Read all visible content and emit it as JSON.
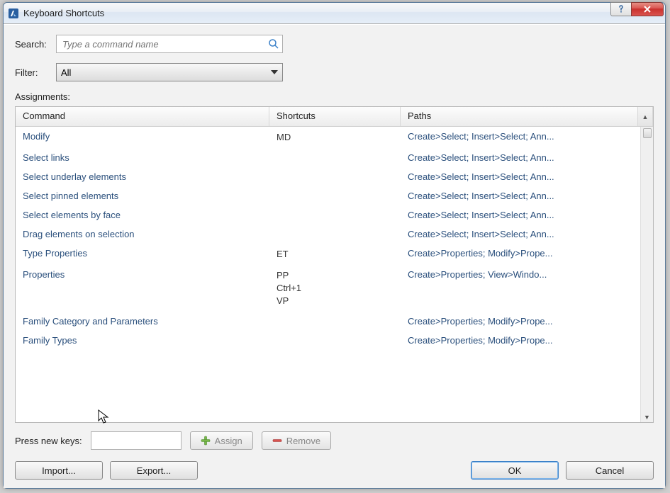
{
  "window": {
    "title": "Keyboard Shortcuts"
  },
  "search": {
    "label": "Search:",
    "placeholder": "Type a command name"
  },
  "filter": {
    "label": "Filter:",
    "value": "All"
  },
  "assignments_label": "Assignments:",
  "columns": {
    "command": "Command",
    "shortcuts": "Shortcuts",
    "paths": "Paths"
  },
  "rows": [
    {
      "command": "Modify",
      "shortcuts": [
        "MD"
      ],
      "paths": "Create>Select; Insert>Select; Ann..."
    },
    {
      "command": "Select links",
      "shortcuts": [],
      "paths": "Create>Select; Insert>Select; Ann..."
    },
    {
      "command": "Select underlay elements",
      "shortcuts": [],
      "paths": "Create>Select; Insert>Select; Ann..."
    },
    {
      "command": "Select pinned elements",
      "shortcuts": [],
      "paths": "Create>Select; Insert>Select; Ann..."
    },
    {
      "command": "Select elements by face",
      "shortcuts": [],
      "paths": "Create>Select; Insert>Select; Ann..."
    },
    {
      "command": "Drag elements on selection",
      "shortcuts": [],
      "paths": "Create>Select; Insert>Select; Ann..."
    },
    {
      "command": "Type Properties",
      "shortcuts": [
        "ET"
      ],
      "paths": "Create>Properties; Modify>Prope..."
    },
    {
      "command": "Properties",
      "shortcuts": [
        "PP",
        "Ctrl+1",
        "VP"
      ],
      "paths": "Create>Properties; View>Windo..."
    },
    {
      "command": "Family Category and Parameters",
      "shortcuts": [],
      "paths": "Create>Properties; Modify>Prope..."
    },
    {
      "command": "Family Types",
      "shortcuts": [],
      "paths": "Create>Properties; Modify>Prope..."
    }
  ],
  "press_keys_label": "Press new keys:",
  "buttons": {
    "assign": "Assign",
    "remove": "Remove",
    "import": "Import...",
    "export": "Export...",
    "ok": "OK",
    "cancel": "Cancel"
  }
}
